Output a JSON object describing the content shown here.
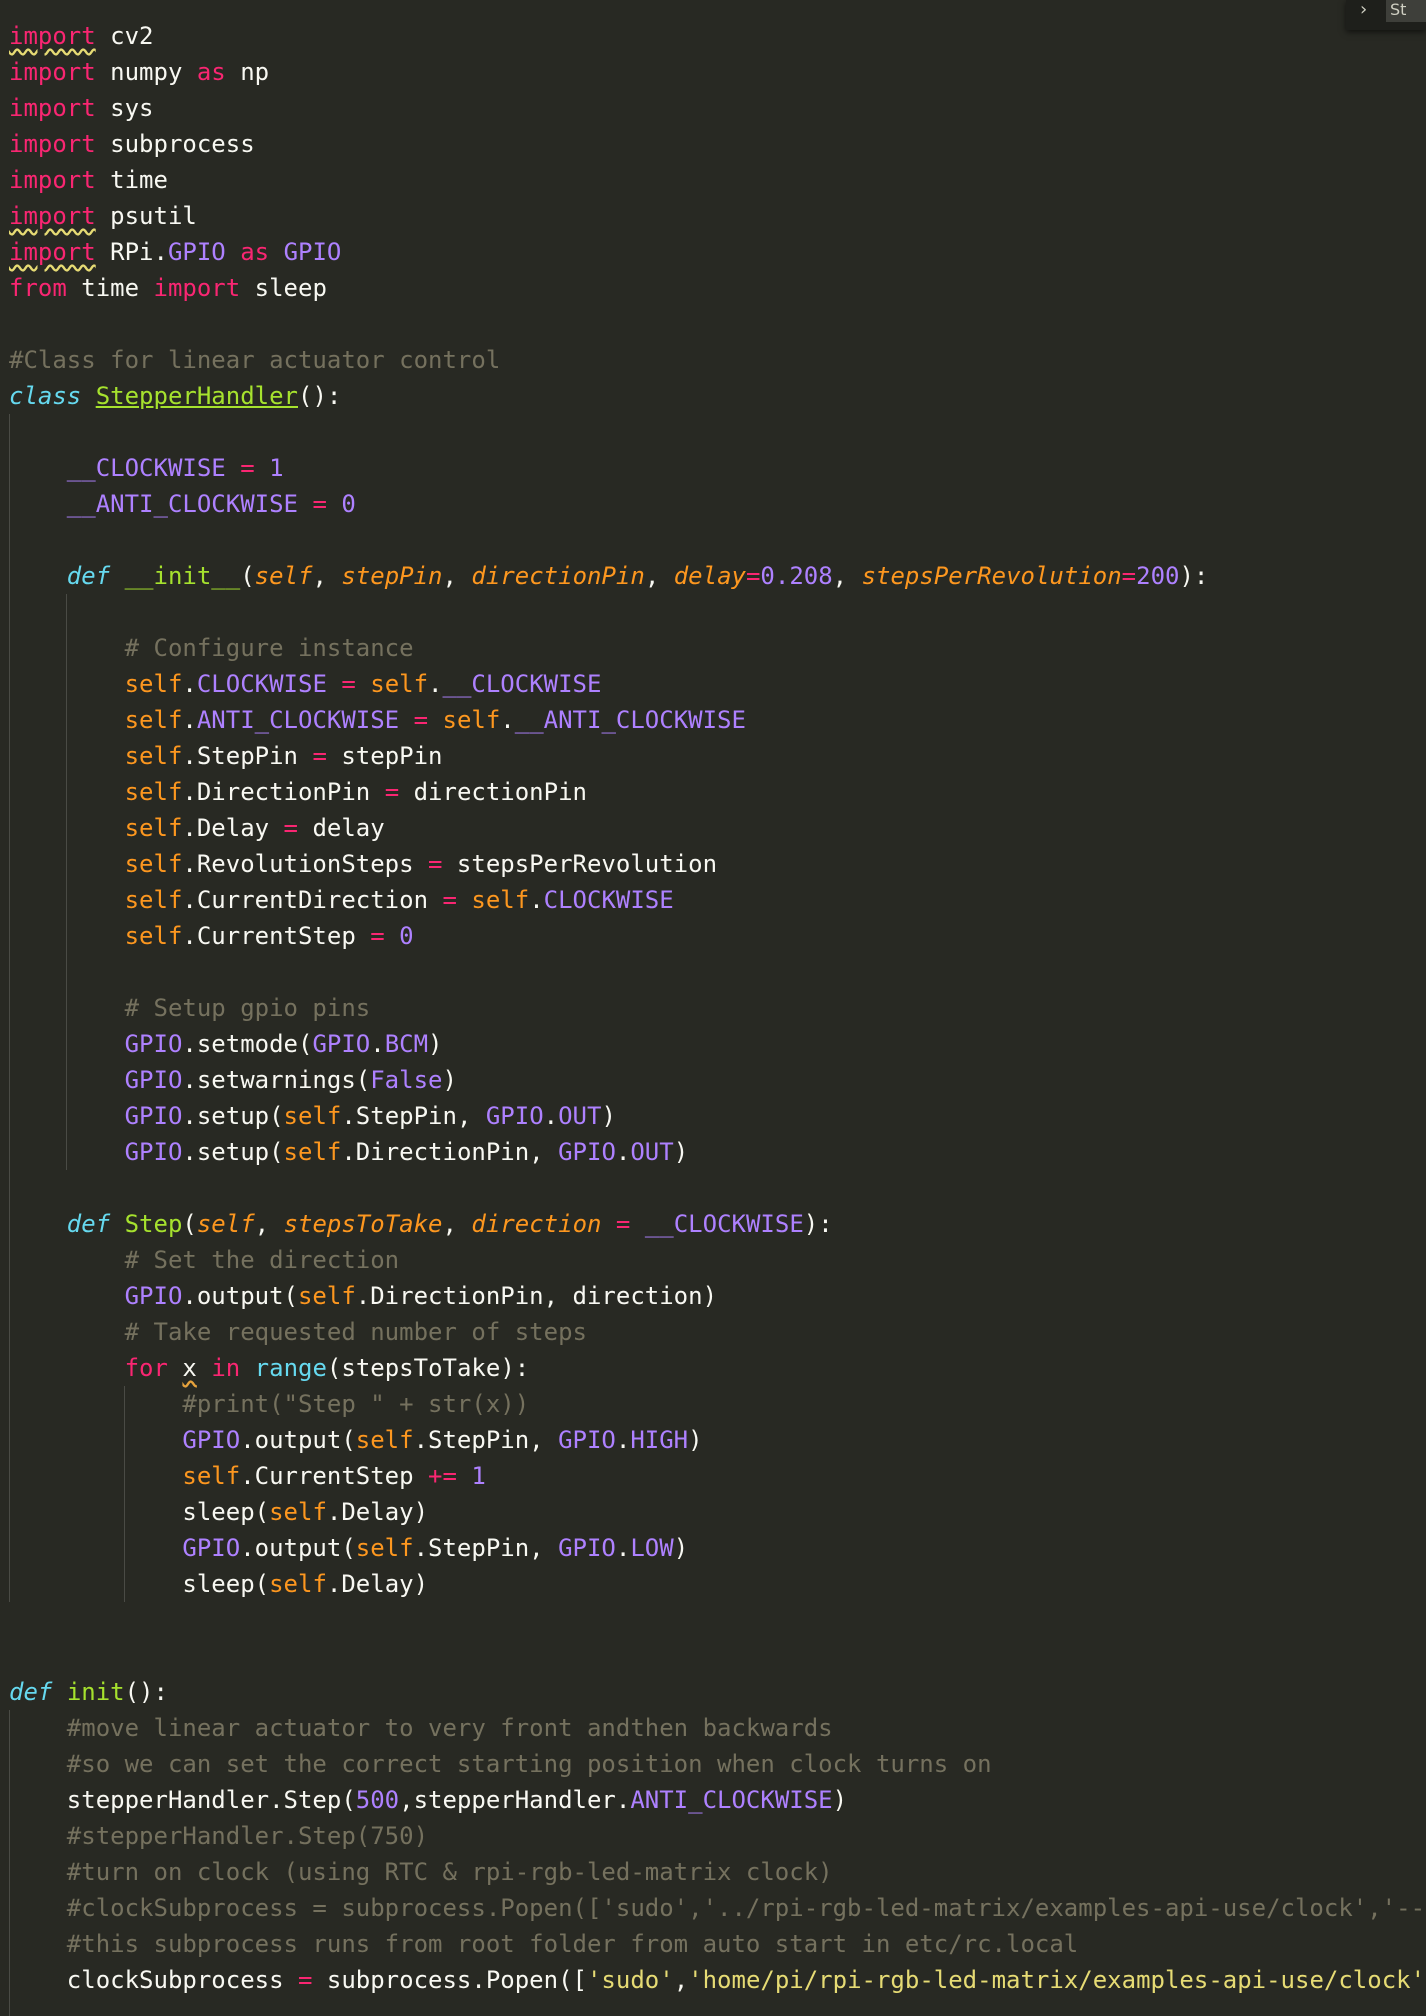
{
  "editor": {
    "language": "python",
    "theme": "monokai",
    "colors": {
      "background": "#282923",
      "text": "#f8f8f2",
      "keyword": "#f92672",
      "storage": "#66d9ef",
      "comment": "#75715e",
      "number": "#ae81ff",
      "string": "#e6db74",
      "self": "#fd971f",
      "function": "#a6e22e"
    },
    "overlay_tab": {
      "chevron": "chevron-right-icon",
      "label": "St"
    },
    "lines": [
      "import cv2",
      "import numpy as np",
      "import sys",
      "import subprocess",
      "import time",
      "import psutil",
      "import RPi.GPIO as GPIO",
      "from time import sleep",
      "",
      "#Class for linear actuator control",
      "class StepperHandler():",
      "",
      "    __CLOCKWISE = 1",
      "    __ANTI_CLOCKWISE = 0",
      "",
      "    def __init__(self, stepPin, directionPin, delay=0.208, stepsPerRevolution=200):",
      "",
      "        # Configure instance",
      "        self.CLOCKWISE = self.__CLOCKWISE",
      "        self.ANTI_CLOCKWISE = self.__ANTI_CLOCKWISE",
      "        self.StepPin = stepPin",
      "        self.DirectionPin = directionPin",
      "        self.Delay = delay",
      "        self.RevolutionSteps = stepsPerRevolution",
      "        self.CurrentDirection = self.CLOCKWISE",
      "        self.CurrentStep = 0",
      "",
      "        # Setup gpio pins",
      "        GPIO.setmode(GPIO.BCM)",
      "        GPIO.setwarnings(False)",
      "        GPIO.setup(self.StepPin, GPIO.OUT)",
      "        GPIO.setup(self.DirectionPin, GPIO.OUT)",
      "",
      "    def Step(self, stepsToTake, direction = __CLOCKWISE):",
      "        # Set the direction",
      "        GPIO.output(self.DirectionPin, direction)",
      "        # Take requested number of steps",
      "        for x in range(stepsToTake):",
      "            #print(\"Step \" + str(x))",
      "            GPIO.output(self.StepPin, GPIO.HIGH)",
      "            self.CurrentStep += 1",
      "            sleep(self.Delay)",
      "            GPIO.output(self.StepPin, GPIO.LOW)",
      "            sleep(self.Delay)",
      "",
      "",
      "def init():",
      "    #move linear actuator to very front andthen backwards",
      "    #so we can set the correct starting position when clock turns on",
      "    stepperHandler.Step(500,stepperHandler.ANTI_CLOCKWISE)",
      "    #stepperHandler.Step(750)",
      "    #turn on clock (using RTC & rpi-rgb-led-matrix clock)",
      "    #clockSubprocess = subprocess.Popen(['sudo','../rpi-rgb-led-matrix/examples-api-use/clock','--",
      "    #this subprocess runs from root folder from auto start in etc/rc.local",
      "    clockSubprocess = subprocess.Popen(['sudo','home/pi/rpi-rgb-led-matrix/examples-api-use/clock'"
    ]
  }
}
